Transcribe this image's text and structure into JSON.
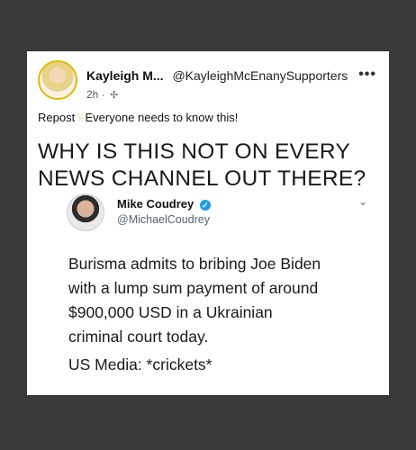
{
  "post": {
    "author_name": "Kayleigh M...",
    "author_handle": "@KayleighMcEnanySupporters",
    "more_icon": "more-horizontal-icon",
    "time": "2h",
    "audience_icon": "globe-icon",
    "caption_prefix": "Repost",
    "caption_emoji": "point-down-emoji",
    "caption_text": "Everyone needs to know this!"
  },
  "image": {
    "headline_line1": "WHY IS THIS NOT ON EVERY",
    "headline_line2": "NEWS CHANNEL OUT THERE?",
    "tweet": {
      "name": "Mike Coudrey",
      "handle": "@MichaelCoudrey",
      "line1": "Burisma admits to bribing Joe Biden",
      "line2": "with a lump sum payment of around",
      "line3": "$900,000 USD in a Ukrainian",
      "line4": "criminal court today.",
      "line5": "US Media: *crickets*"
    }
  },
  "colors": {
    "background": "#3a3a3a",
    "card": "#ffffff",
    "verified": "#1d9bf0",
    "avatar_ring": "#e6b800"
  }
}
